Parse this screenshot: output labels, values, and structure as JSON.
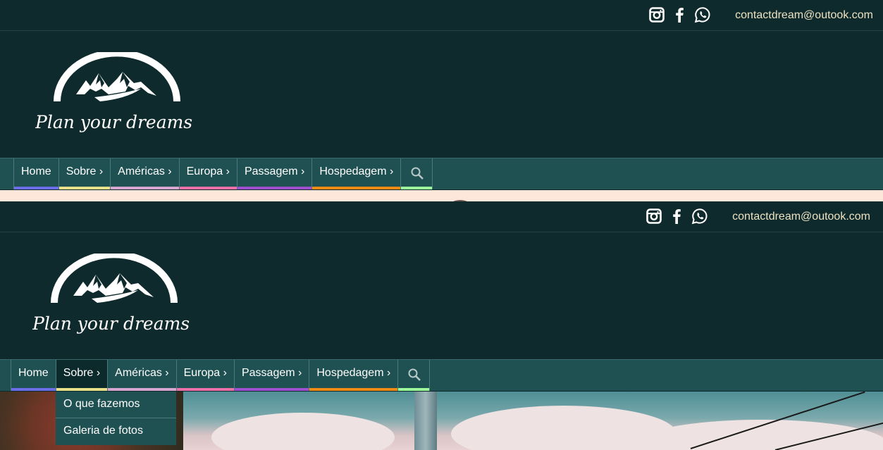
{
  "contact": {
    "email": "contactdream@outook.com"
  },
  "social": [
    {
      "name": "instagram-icon"
    },
    {
      "name": "facebook-icon"
    },
    {
      "name": "whatsapp-icon"
    }
  ],
  "logo": {
    "text": "Plan your dreams"
  },
  "nav": {
    "items": [
      {
        "label": "Home",
        "color": "#6b6ee8"
      },
      {
        "label": "Sobre ›",
        "color": "#e9e08a"
      },
      {
        "label": "Américas ›",
        "color": "#d6a6d0"
      },
      {
        "label": "Europa ›",
        "color": "#ec6fa8"
      },
      {
        "label": "Passagem ›",
        "color": "#a04ed0"
      },
      {
        "label": "Hospedagem ›",
        "color": "#f08a12"
      }
    ],
    "search": {
      "icon": "search-icon",
      "color": "#9dfa9a"
    }
  },
  "dropdown": {
    "items": [
      {
        "label": "O que fazemos"
      },
      {
        "label": "Galeria de fotos"
      }
    ]
  },
  "colors": {
    "header_bg": "#0f2a2c",
    "nav_bg": "#1f5052",
    "email_text": "#ede3c2"
  }
}
